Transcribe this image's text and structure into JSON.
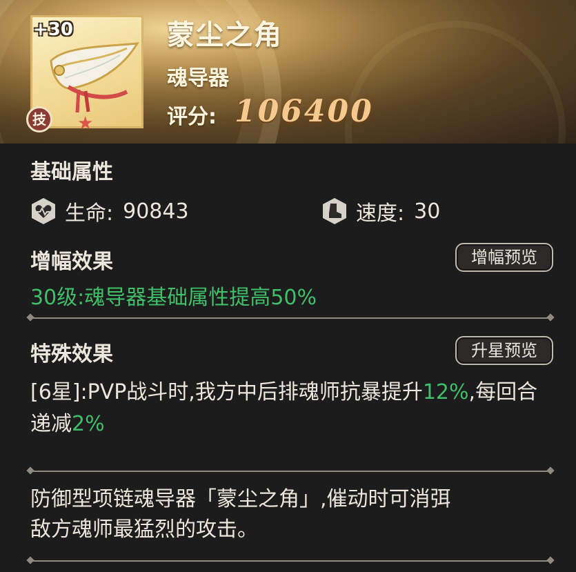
{
  "item": {
    "level_bonus": "+30",
    "name": "蒙尘之角",
    "type": "魂导器",
    "score_label": "评分:",
    "score_value": "106400",
    "skill_badge": "技",
    "star_icon": "star-icon"
  },
  "base": {
    "title": "基础属性",
    "hp_label": "生命:",
    "hp_value": "90843",
    "hp_icon": "heart-shield-icon",
    "speed_label": "速度:",
    "speed_value": "30",
    "speed_icon": "boot-icon"
  },
  "amplify": {
    "title": "增幅效果",
    "button": "增幅预览",
    "text": "30级:魂导器基础属性提高50%"
  },
  "special": {
    "title": "特殊效果",
    "button": "升星预览",
    "prefix": "[6星]:PVP战斗时,我方中后排魂师抗暴提升",
    "value1": "12%",
    "middle": ",每回合递减",
    "value2": "2%"
  },
  "description": {
    "line1": "防御型项链魂导器「蒙尘之角」,催动时可消弭",
    "line2": "敌方魂师最猛烈的攻击。"
  },
  "colors": {
    "green": "#3fbf6a",
    "score_gold": "#f5c98f",
    "background": "#1d1c1c"
  }
}
